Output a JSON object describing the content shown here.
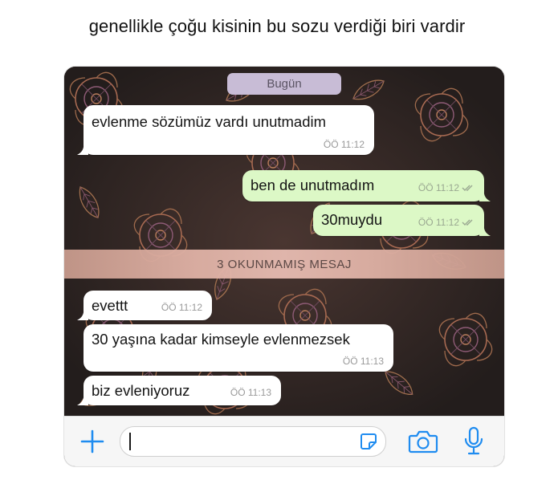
{
  "caption": "genellikle çoğu kisinin bu sozu verdiği biri vardir",
  "chat": {
    "date_chip": "Bugün",
    "unread_banner": "3 OKUNMAMIŞ MESAJ",
    "messages": [
      {
        "direction": "incoming",
        "text": "evlenme sözümüz vardı unutmadim",
        "time": "ÖÖ 11:12"
      },
      {
        "direction": "outgoing",
        "text": "ben de unutmadım",
        "time": "ÖÖ 11:12",
        "status": "read"
      },
      {
        "direction": "outgoing",
        "text": "30muydu",
        "time": "ÖÖ 11:12",
        "status": "read"
      },
      {
        "direction": "incoming",
        "text": "evettt",
        "time": "ÖÖ 11:12"
      },
      {
        "direction": "incoming",
        "text": "30 yaşına kadar kimseyle evlenmezsek",
        "time": "ÖÖ 11:13"
      },
      {
        "direction": "incoming",
        "text": "biz evleniyoruz",
        "time": "ÖÖ 11:13"
      }
    ]
  },
  "input_bar": {
    "message_value": "",
    "icons": [
      "plus-icon",
      "sticker-icon",
      "camera-icon",
      "microphone-icon"
    ]
  },
  "colors": {
    "accent": "#1f8cf0",
    "incoming_bubble": "#ffffff",
    "outgoing_bubble": "#dcf8c6",
    "wallpaper": "#2a2422"
  }
}
